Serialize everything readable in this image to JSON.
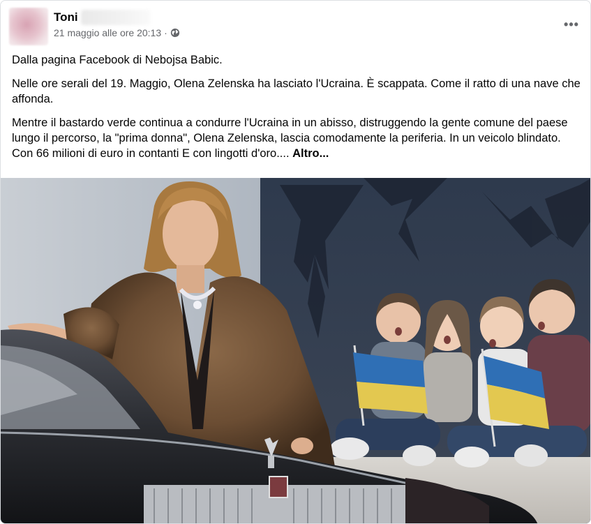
{
  "post": {
    "author": "Toni",
    "date": "21 maggio alle ore 20:13",
    "separator": "·",
    "audience_icon": "globe-icon",
    "more_icon": "more-options-icon",
    "more_label": "•••",
    "paragraphs": [
      "Dalla pagina Facebook di Nebojsa Babic.",
      "Nelle ore serali del 19. Maggio, Olena Zelenska ha lasciato l'Ucraina. È scappata. Come il ratto di una nave che affonda.",
      "Mentre il bastardo verde continua a condurre l'Ucraina in un abisso, distruggendo la gente comune del paese lungo il percorso, la \"prima donna\", Olena Zelenska, lascia comodamente la periferia. In un veicolo blindato. Con 66 milioni di euro in contanti E con lingotti d'oro.... "
    ],
    "see_more": "Altro..."
  },
  "colors": {
    "text": "#050505",
    "meta": "#65676b",
    "flag_blue": "#2f6fb5",
    "flag_yellow": "#e3c850"
  }
}
